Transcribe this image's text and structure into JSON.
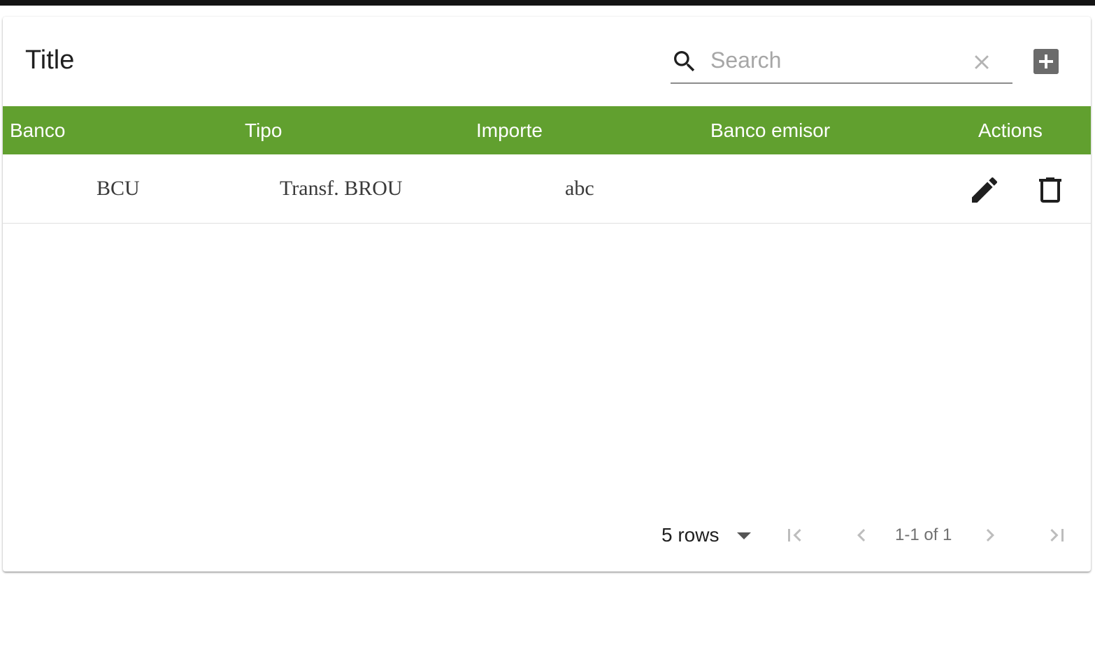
{
  "table": {
    "title": "Title",
    "search": {
      "placeholder": "Search",
      "value": ""
    },
    "columns": [
      "Banco",
      "Tipo",
      "Importe",
      "Banco emisor",
      "Actions"
    ],
    "rows": [
      {
        "banco": "BCU",
        "tipo": "Transf. BROU",
        "importe": "abc",
        "banco_emisor": ""
      }
    ]
  },
  "pagination": {
    "rows_per_page_label": "5 rows",
    "range": "1-1 of 1"
  },
  "icons": {
    "search": "search-icon",
    "clear": "clear-icon",
    "add": "add-box-icon",
    "edit": "edit-icon",
    "delete": "delete-icon",
    "first": "first-page-icon",
    "prev": "chevron-left-icon",
    "next": "chevron-right-icon",
    "last": "last-page-icon"
  },
  "colors": {
    "header_bg": "#61a02f",
    "header_text": "#ffffff",
    "add_button": "#6b6b6b"
  }
}
